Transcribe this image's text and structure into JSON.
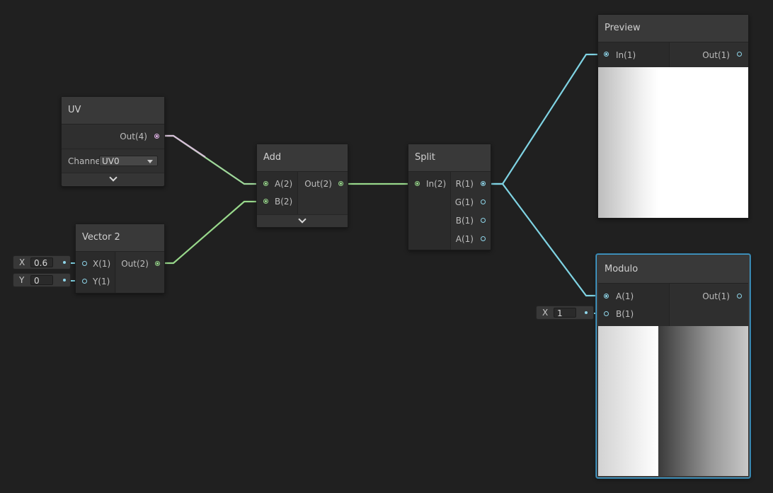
{
  "nodes": {
    "uv": {
      "title": "UV",
      "out_label": "Out(4)",
      "channel_label": "Channe",
      "channel_value": "UV0"
    },
    "vector2": {
      "title": "Vector 2",
      "in_x": "X(1)",
      "in_y": "Y(1)",
      "out_label": "Out(2)",
      "x_field_label": "X",
      "x_value": "0.6",
      "y_field_label": "Y",
      "y_value": "0"
    },
    "add": {
      "title": "Add",
      "in_a": "A(2)",
      "in_b": "B(2)",
      "out_label": "Out(2)"
    },
    "split": {
      "title": "Split",
      "in_label": "In(2)",
      "out_r": "R(1)",
      "out_g": "G(1)",
      "out_b": "B(1)",
      "out_a": "A(1)"
    },
    "preview": {
      "title": "Preview",
      "in_label": "In(1)",
      "out_label": "Out(1)"
    },
    "modulo": {
      "title": "Modulo",
      "in_a": "A(1)",
      "in_b": "B(1)",
      "out_label": "Out(1)",
      "b_field_label": "X",
      "b_value": "1"
    }
  },
  "colors": {
    "background": "#202020",
    "wire_float": "#7fd3e3",
    "wire_vector2": "#98d88b",
    "wire_vector4": "#e0b3e6",
    "selection": "#44a6d8"
  },
  "icons": [
    "chevron-down-icon",
    "dropdown-caret-icon",
    "port-dot-icon"
  ]
}
